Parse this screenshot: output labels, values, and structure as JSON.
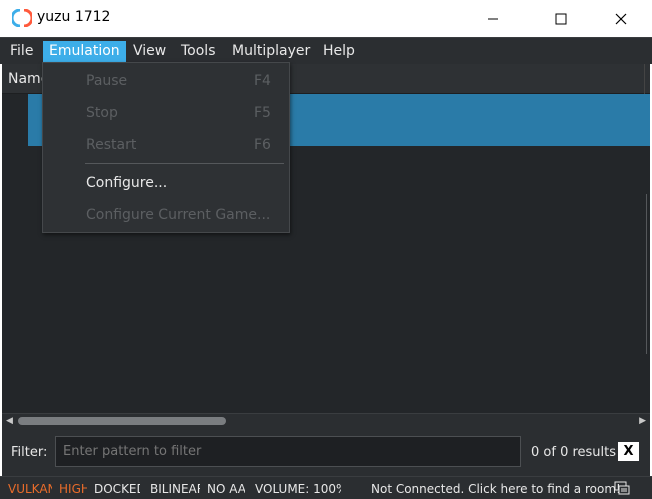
{
  "window": {
    "title": "yuzu 1712",
    "minimize_glyph": "—",
    "maximize_glyph": "☐",
    "close_glyph": "✕"
  },
  "menubar": {
    "items": [
      {
        "label": "File"
      },
      {
        "label": "Emulation"
      },
      {
        "label": "View"
      },
      {
        "label": "Tools"
      },
      {
        "label": "Multiplayer"
      },
      {
        "label": "Help"
      }
    ]
  },
  "emulation_menu": {
    "items": [
      {
        "label": "Pause",
        "shortcut": "F4",
        "enabled": false
      },
      {
        "label": "Stop",
        "shortcut": "F5",
        "enabled": false
      },
      {
        "label": "Restart",
        "shortcut": "F6",
        "enabled": false
      },
      {
        "label": "Configure...",
        "shortcut": "",
        "enabled": true
      },
      {
        "label": "Configure Current Game...",
        "shortcut": "",
        "enabled": false
      }
    ]
  },
  "game_list": {
    "column_header": "Name"
  },
  "filter": {
    "label": "Filter:",
    "placeholder": "Enter pattern to filter",
    "results": "0 of 0 results",
    "clear_label": "X"
  },
  "statusbar": {
    "api": "VULKAN",
    "accuracy": "HIGH",
    "dock_mode": "DOCKED",
    "scaling_filter": "BILINEAR",
    "anti_aliasing": "NO AA",
    "volume": "VOLUME: 100%",
    "room_status": "Not Connected. Click here to find a room!"
  },
  "colors": {
    "accent": "#3daee9",
    "selection": "#2a7ba8",
    "warning_text": "#e96c2a",
    "background": "#232629"
  }
}
